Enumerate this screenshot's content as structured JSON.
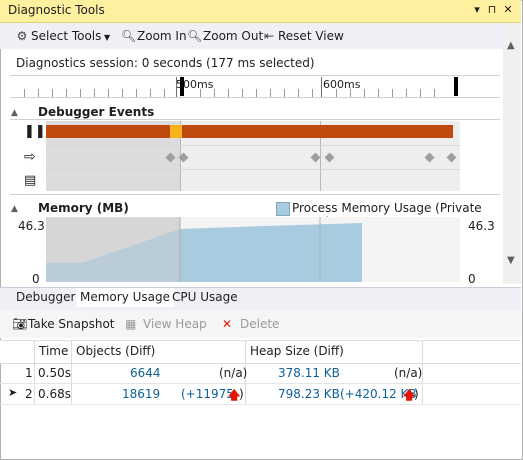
{
  "window": {
    "title": "Diagnostic Tools",
    "title_buttons": [
      "▾",
      "⊓",
      "✕"
    ]
  },
  "toolbar": {
    "select_tools": "Select Tools",
    "zoom_in": "Zoom In",
    "zoom_out": "Zoom Out",
    "reset_view": "Reset View"
  },
  "session": {
    "text": "Diagnostics session: 0 seconds (177 ms selected)"
  },
  "ruler": {
    "label_500": "500ms",
    "label_600": "600ms"
  },
  "debugger_events": {
    "heading": "Debugger Events"
  },
  "memory": {
    "heading": "Memory (MB)",
    "legend": "Process Memory Usage (Private Bytes)",
    "y_max_left": "46.3",
    "y_min_left": "0",
    "y_max_right": "46.3",
    "y_min_right": "0",
    "series_color": "#a8cbdf"
  },
  "tabs": {
    "debugger": "Debugger",
    "memory_usage": "Memory Usage",
    "cpu_usage": "CPU Usage"
  },
  "actions": {
    "take_snapshot": "Take Snapshot",
    "view_heap": "View Heap",
    "delete": "Delete"
  },
  "table": {
    "columns": [
      "Time",
      "Objects (Diff)",
      "Heap Size (Diff)"
    ],
    "rows": [
      {
        "id": "1",
        "time": "0.50s",
        "objects": "6644",
        "objects_diff": "(n/a)",
        "heap": "378.11 KB",
        "heap_diff": "(n/a)"
      },
      {
        "id": "2",
        "time": "0.68s",
        "objects": "18619",
        "objects_diff": "(+11975",
        "heap": "798.23 KB",
        "heap_diff": "(+420.12 KB"
      }
    ]
  },
  "colors": {
    "title_bg": "#fdf09f",
    "event_bar": "#c04a0e",
    "event_highlight": "#f6b31d",
    "link": "#0e6198",
    "increase_arrow": "#e51400"
  }
}
